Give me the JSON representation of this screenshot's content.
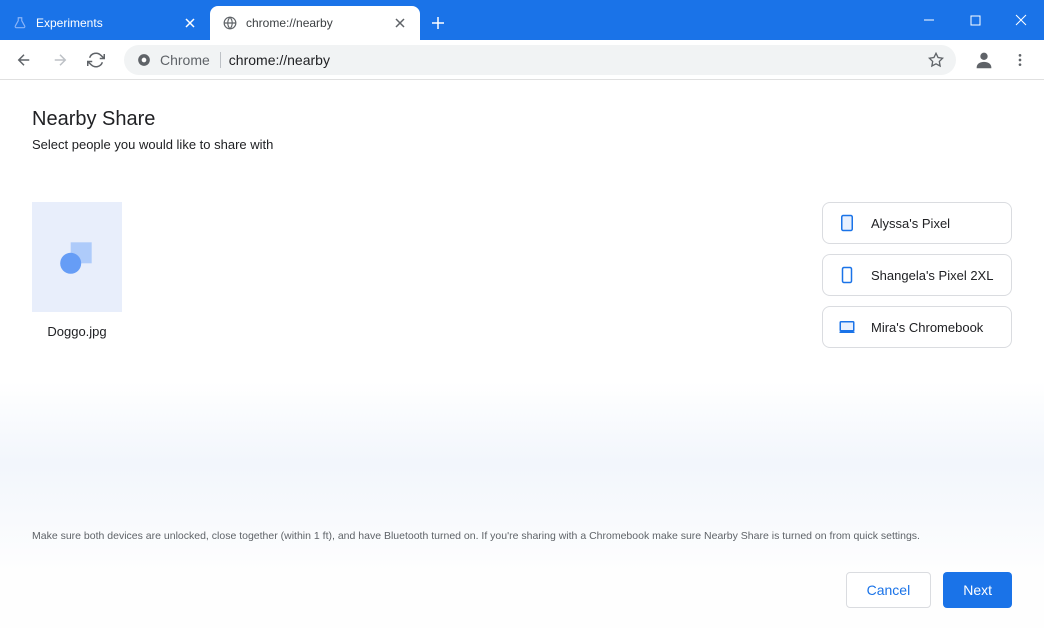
{
  "window": {
    "tabs": [
      {
        "title": "Experiments",
        "active": false
      },
      {
        "title": "chrome://nearby",
        "active": true
      }
    ]
  },
  "omnibox": {
    "secure_label": "Chrome",
    "url": "chrome://nearby"
  },
  "page": {
    "title": "Nearby Share",
    "subtitle": "Select people you would like to share with",
    "file_name": "Doggo.jpg",
    "help_text": "Make sure both devices are unlocked, close together (within 1 ft), and have Bluetooth turned on. If you're sharing with a Chromebook make sure Nearby Share is turned on from quick settings.",
    "cancel_label": "Cancel",
    "next_label": "Next"
  },
  "devices": [
    {
      "name": "Alyssa's Pixel",
      "type": "phone"
    },
    {
      "name": "Shangela's Pixel 2XL",
      "type": "phone"
    },
    {
      "name": "Mira's Chromebook",
      "type": "laptop"
    }
  ]
}
